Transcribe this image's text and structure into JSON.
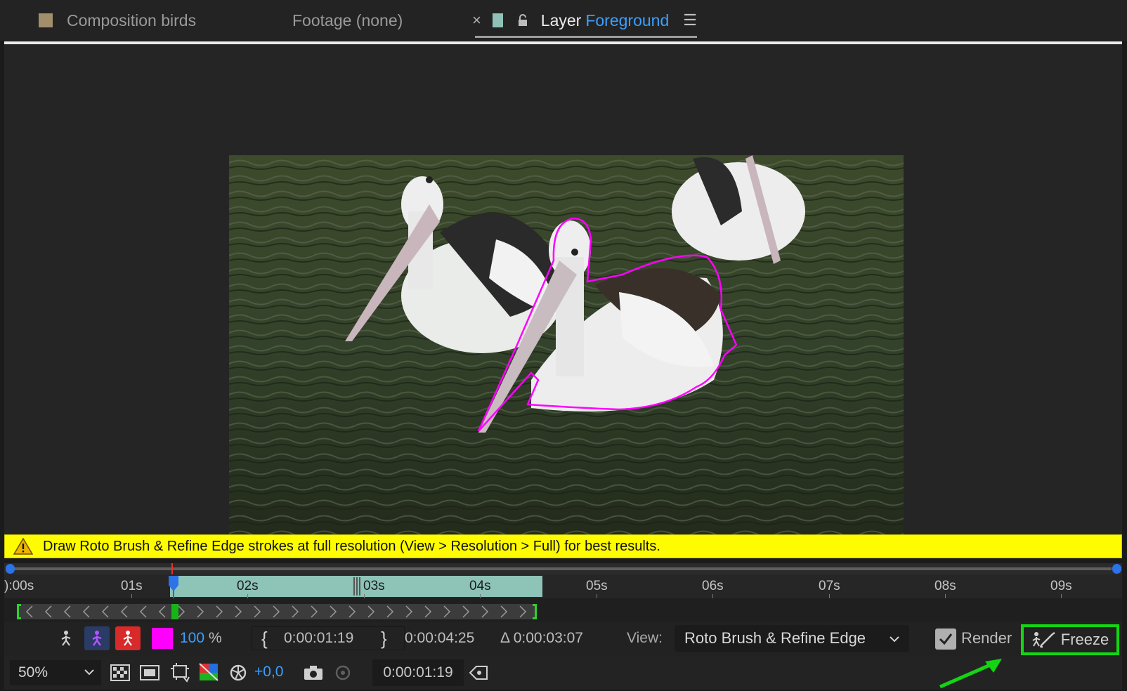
{
  "tabs": {
    "composition": "Composition birds",
    "footage": "Footage (none)",
    "layer_prefix": "Layer",
    "layer_name": "Foreground"
  },
  "warning": "Draw Roto Brush & Refine Edge strokes at full resolution (View > Resolution > Full) for best results.",
  "timeline": {
    "ticks": [
      "):00s",
      "01s",
      "02s",
      "03s",
      "04s",
      "05s",
      "06s",
      "07s",
      "08s",
      "09s"
    ]
  },
  "tools_row": {
    "opacity_value": "100",
    "opacity_unit": "%",
    "in_time": "0:00:01:19",
    "out_time": "0:00:04:25",
    "duration": "Δ 0:00:03:07",
    "view_label": "View:",
    "view_value": "Roto Brush & Refine Edge",
    "render_label": "Render",
    "freeze_label": "Freeze"
  },
  "bottom_row": {
    "zoom": "50%",
    "exposure": "+0,0",
    "current_time": "0:00:01:19"
  },
  "colors": {
    "overlay_magenta": "#ff00ff",
    "accent_blue": "#3aa0ff",
    "warning_yellow": "#fffb00",
    "highlight_green": "#13d513"
  }
}
